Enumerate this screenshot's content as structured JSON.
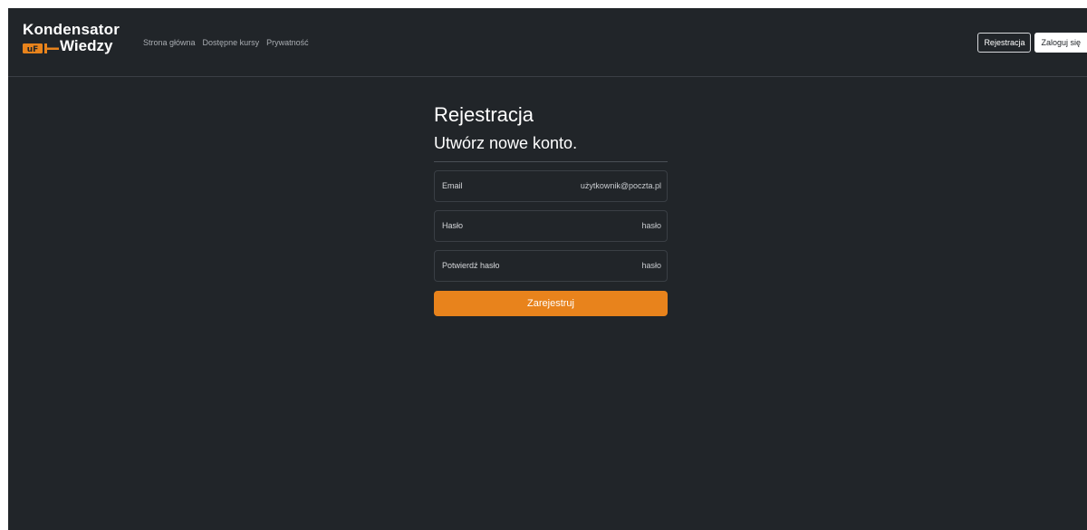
{
  "brand": {
    "line1": "Kondensator",
    "line2": "Wiedzy",
    "logo_text": "uF"
  },
  "nav": {
    "links": [
      "Strona główna",
      "Dostępne kursy",
      "Prywatność"
    ],
    "register_label": "Rejestracja",
    "login_label": "Zaloguj się"
  },
  "form": {
    "title": "Rejestracja",
    "subtitle": "Utwórz nowe konto.",
    "email_label": "Email",
    "email_placeholder": "użytkownik@poczta.pl",
    "password_label": "Hasło",
    "password_placeholder": "hasło",
    "confirm_label": "Potwierdź hasło",
    "confirm_placeholder": "hasło",
    "submit_label": "Zarejestruj"
  },
  "colors": {
    "background": "#212529",
    "accent": "#e8831c"
  }
}
